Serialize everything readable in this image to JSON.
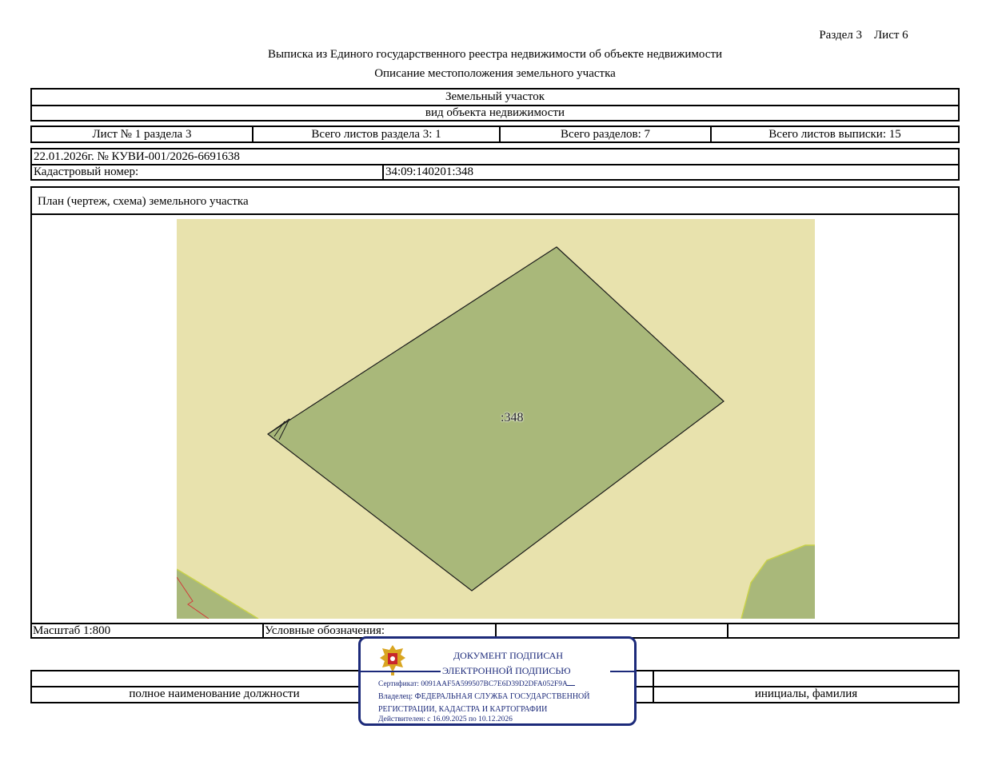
{
  "header": {
    "section_sheet": "Раздел 3    Лист 6",
    "title": "Выписка из Единого государственного реестра недвижимости об объекте недвижимости",
    "subtitle": "Описание местоположения земельного участка"
  },
  "object": {
    "type": "Земельный участок",
    "type_caption": "вид объекта недвижимости"
  },
  "sheet_info": {
    "sheet": "Лист № 1 раздела 3",
    "total_sheets_section": "Всего листов раздела 3: 1",
    "total_sections": "Всего разделов: 7",
    "total_sheets": "Всего листов выписки: 15"
  },
  "doc": {
    "date_number": "22.01.2026г. № КУВИ-001/2026-6691638",
    "cadastral_label": "Кадастровый номер:",
    "cadastral_value": "34:09:140201:348"
  },
  "plan": {
    "title": "План (чертеж, схема) земельного участка",
    "parcel_label": ":348",
    "colors": {
      "background": "#e8e2ad",
      "parcel": "#a9b87a"
    }
  },
  "legend": {
    "scale": "Масштаб 1:800",
    "legend_label": "Условные обозначения:"
  },
  "signature": {
    "position_caption": "полное наименование должности",
    "name_caption": "инициалы, фамилия"
  },
  "stamp": {
    "line1": "ДОКУМЕНТ ПОДПИСАН",
    "line2": "ЭЛЕКТРОННОЙ ПОДПИСЬЮ",
    "certificate": "Сертификат: 0091AAF5A599507BC7E6D39D2DFA052F9A",
    "owner_line1": "Владелец: ФЕДЕРАЛЬНАЯ СЛУЖБА ГОСУДАРСТВЕННОЙ",
    "owner_line2": "РЕГИСТРАЦИИ, КАДАСТРА И КАРТОГРАФИИ",
    "valid": "Действителен: с 16.09.2025 по 10.12.2026",
    "color": "#1c2a7a"
  }
}
